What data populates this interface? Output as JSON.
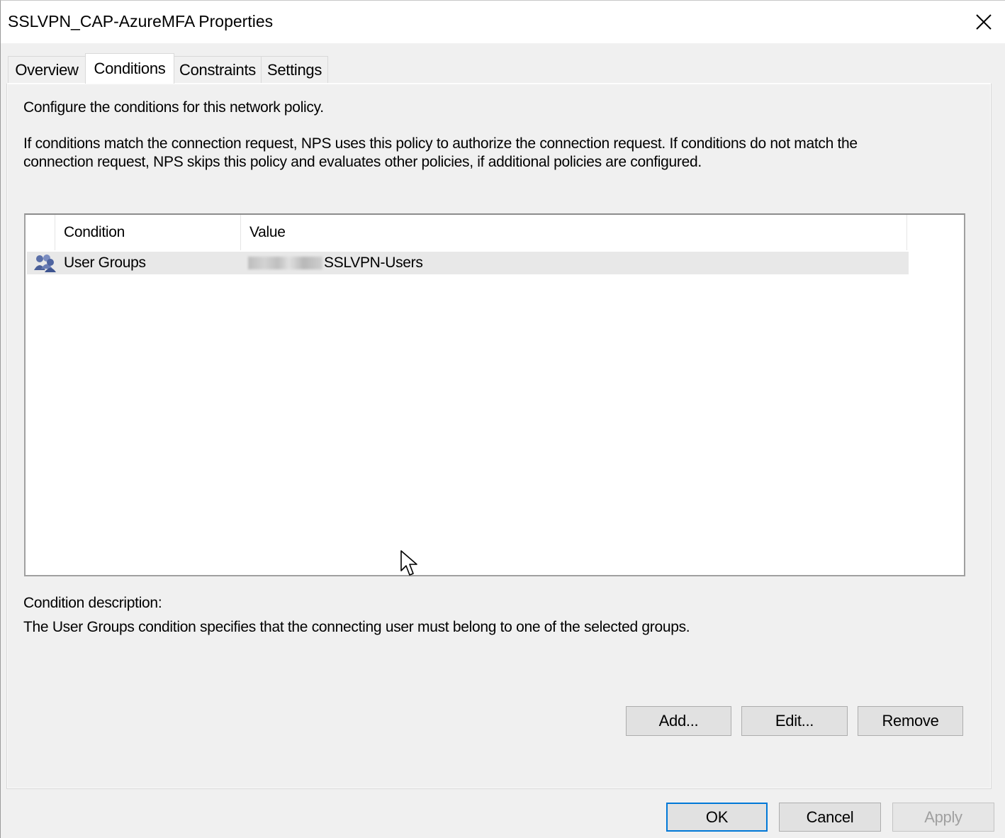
{
  "window": {
    "title": "SSLVPN_CAP-AzureMFA Properties"
  },
  "tabs": [
    {
      "label": "Overview",
      "active": false
    },
    {
      "label": "Conditions",
      "active": true
    },
    {
      "label": "Constraints",
      "active": false
    },
    {
      "label": "Settings",
      "active": false
    }
  ],
  "conditions": {
    "intro": "Configure the conditions for this network policy.",
    "explanation_line1": "If conditions match the connection request, NPS uses this policy to authorize the connection request. If conditions do not match the",
    "explanation_line2": "connection request, NPS skips this policy and evaluates other policies, if additional policies are configured.",
    "list": {
      "columns": [
        "Condition",
        "Value"
      ],
      "rows": [
        {
          "icon": "user-groups-icon",
          "condition": "User Groups",
          "value": "SSLVPN-Users"
        }
      ]
    },
    "description_label": "Condition description:",
    "description_text": "The User Groups condition specifies that the connecting user must belong to one of the selected groups.",
    "buttons": {
      "add": "Add...",
      "edit": "Edit...",
      "remove": "Remove"
    }
  },
  "footer": {
    "ok": "OK",
    "cancel": "Cancel",
    "apply": "Apply"
  },
  "colors": {
    "accent": "#0078d7",
    "selected_row": "#e8e8e8"
  }
}
